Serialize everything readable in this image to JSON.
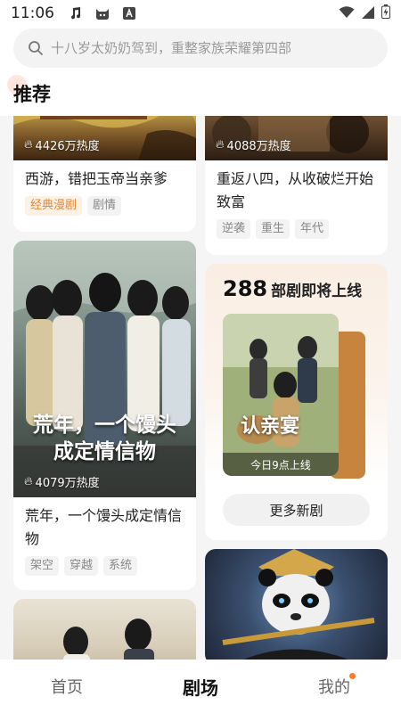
{
  "status_bar": {
    "time": "11:06",
    "left_icons": [
      "music-icon",
      "cat-app-icon",
      "a-app-icon"
    ],
    "right_icons": [
      "wifi-icon",
      "signal-icon",
      "battery-icon"
    ]
  },
  "search": {
    "placeholder": "十八岁太奶奶驾到，重整家族荣耀第四部"
  },
  "section": {
    "title": "推荐"
  },
  "cards": [
    {
      "heat": "4426万热度",
      "title": "西游，错把玉帝当亲爹",
      "tags": [
        {
          "label": "经典漫剧",
          "highlight": true
        },
        {
          "label": "剧情",
          "highlight": false
        }
      ]
    },
    {
      "heat": "4088万热度",
      "title": "重返八四，从收破烂开始致富",
      "tags": [
        {
          "label": "逆袭",
          "highlight": false
        },
        {
          "label": "重生",
          "highlight": false
        },
        {
          "label": "年代",
          "highlight": false
        }
      ]
    },
    {
      "poster_text_line1": "荒年，一个馒头",
      "poster_text_line2": "成定情信物",
      "heat": "4079万热度",
      "title": "荒年，一个馒头成定情信物",
      "tags": [
        {
          "label": "架空",
          "highlight": false
        },
        {
          "label": "穿越",
          "highlight": false
        },
        {
          "label": "系统",
          "highlight": false
        }
      ]
    }
  ],
  "upcoming": {
    "count": "288",
    "label": "部剧即将上线",
    "poster_title": "认亲宴",
    "release": "今日9点上线",
    "more_button": "更多新剧"
  },
  "bottom_nav": {
    "items": [
      {
        "label": "首页",
        "active": false
      },
      {
        "label": "剧场",
        "active": true
      },
      {
        "label": "我的",
        "active": false,
        "badge": true
      }
    ]
  },
  "colors": {
    "accent_orange": "#e0883a",
    "badge_dot": "#ff7a2f",
    "background": "#f5f5f5"
  }
}
